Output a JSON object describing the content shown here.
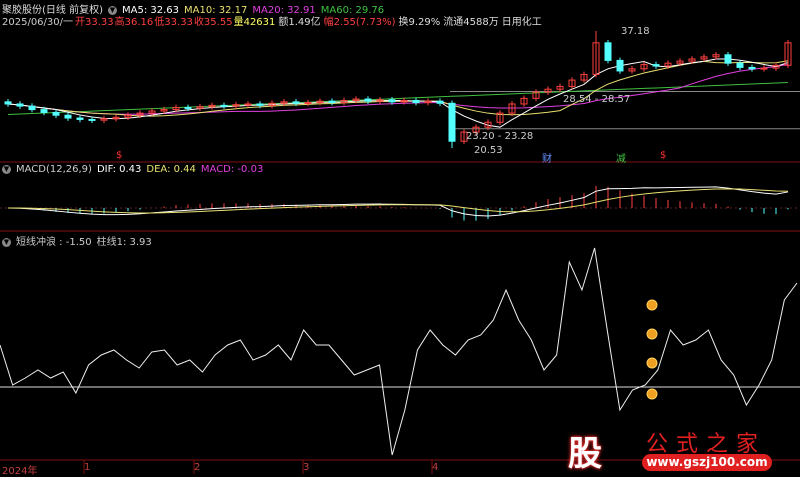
{
  "header": {
    "stock": "聚胶股份(日线 前复权)",
    "ma5": "MA5: 32.63",
    "ma10": "MA10: 32.17",
    "ma20": "MA20: 32.91",
    "ma60": "MA60: 29.76",
    "date": "2025/06/30/一",
    "open": "开33.33",
    "high": "高36.16",
    "low": "低33.33",
    "close": "收35.55",
    "volume": "量42631",
    "amount": "额1.49亿",
    "change": "幅2.55(7.73%)",
    "turnover": "换9.29%",
    "float": "流通4588万",
    "industry": "日用化工"
  },
  "macd_header": {
    "name": "MACD(12,26,9)",
    "dif": "DIF: 0.43",
    "dea": "DEA: 0.44",
    "macd": "MACD: -0.03"
  },
  "osc_header": {
    "name": "短线冲浪 : -1.50",
    "bar": "柱线1: 3.93"
  },
  "markers": {
    "cai": "财",
    "jian": "减",
    "dollar": "$"
  },
  "price_labels": {
    "high": "37.18",
    "low": "20.53",
    "zone_upper": "28.54 - 28.57",
    "zone_lower": "23.20 - 23.28"
  },
  "x_axis": [
    "2024年",
    "1",
    "2",
    "3",
    "4"
  ],
  "watermark": {
    "logo": "股",
    "name": "公式之家",
    "url": "www.gszj100.com"
  },
  "colors": {
    "up": "#ff4040",
    "down": "#54ffff",
    "ma5": "#ffffff",
    "ma10": "#e8e070",
    "ma20": "#e040e0",
    "ma60": "#40c040",
    "grid": "#801010"
  },
  "chart_data": [
    {
      "type": "candlestick",
      "title": "聚胶股份 日线",
      "ylim": [
        20.0,
        38.0
      ],
      "closes": [
        26.8,
        26.5,
        26.0,
        25.6,
        25.2,
        24.8,
        24.6,
        24.5,
        24.7,
        24.9,
        25.2,
        25.5,
        25.8,
        26.0,
        26.3,
        26.2,
        26.4,
        26.6,
        26.5,
        26.7,
        26.8,
        26.6,
        26.9,
        27.1,
        26.9,
        27.0,
        27.2,
        27.0,
        27.3,
        27.5,
        27.2,
        27.4,
        27.1,
        27.3,
        27.0,
        27.2,
        26.9,
        21.5,
        22.8,
        23.5,
        24.2,
        25.5,
        26.8,
        27.6,
        28.5,
        28.9,
        29.3,
        30.2,
        31.0,
        35.5,
        33.0,
        31.5,
        31.8,
        32.4,
        32.2,
        32.6,
        32.9,
        33.2,
        33.5,
        33.8,
        32.6,
        32.0,
        31.8,
        31.9,
        32.3,
        35.5
      ],
      "annotated_high": 37.18,
      "annotated_low": 20.53,
      "levels": [
        28.57,
        23.28
      ]
    },
    {
      "type": "line",
      "title": "短线冲浪",
      "ylim": [
        -8,
        15
      ],
      "values": [
        4.2,
        0.2,
        0.9,
        1.7,
        0.9,
        1.5,
        -0.6,
        2.2,
        3.2,
        3.7,
        2.7,
        1.9,
        3.5,
        3.7,
        2.2,
        2.7,
        1.5,
        3.2,
        4.2,
        4.7,
        2.7,
        3.2,
        4.2,
        2.7,
        5.7,
        4.2,
        4.2,
        2.7,
        1.2,
        1.7,
        2.2,
        -6.8,
        -2.3,
        3.7,
        5.7,
        4.2,
        3.2,
        4.7,
        5.2,
        6.7,
        9.7,
        6.7,
        4.7,
        1.7,
        3.2,
        12.5,
        9.7,
        13.9,
        5.7,
        -2.3,
        -0.3,
        0.2,
        1.7,
        5.7,
        4.2,
        4.7,
        5.7,
        2.7,
        1.2,
        -1.8,
        0.2,
        2.7,
        8.7,
        10.4
      ]
    }
  ]
}
